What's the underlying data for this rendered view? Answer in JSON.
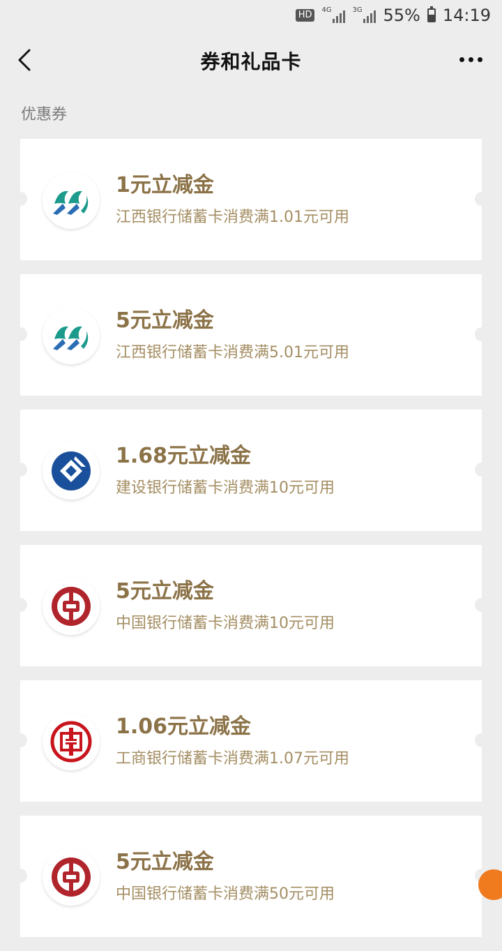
{
  "status_bar": {
    "hd": "HD",
    "network_1": "4G",
    "network_2": "3G",
    "battery_pct": "55%",
    "battery_level": 0.55,
    "time": "14:19"
  },
  "header": {
    "title": "券和礼品卡",
    "back_icon": "chevron-left-icon",
    "more_icon": "more-dots-icon"
  },
  "section": {
    "title": "优惠券"
  },
  "coupons": [
    {
      "amount": "1元立减金",
      "condition": "江西银行储蓄卡消费满1.01元可用",
      "logo": "jiangxi-bank-logo"
    },
    {
      "amount": "5元立减金",
      "condition": "江西银行储蓄卡消费满5.01元可用",
      "logo": "jiangxi-bank-logo"
    },
    {
      "amount": "1.68元立减金",
      "condition": "建设银行储蓄卡消费满10元可用",
      "logo": "ccb-logo"
    },
    {
      "amount": "5元立减金",
      "condition": "中国银行储蓄卡消费满10元可用",
      "logo": "boc-logo"
    },
    {
      "amount": "1.06元立减金",
      "condition": "工商银行储蓄卡消费满1.07元可用",
      "logo": "icbc-logo"
    },
    {
      "amount": "5元立减金",
      "condition": "中国银行储蓄卡消费满50元可用",
      "logo": "boc-logo"
    }
  ],
  "colors": {
    "background": "#ededed",
    "card": "#ffffff",
    "amount_text": "#8b7247",
    "condition_text": "#a48e63",
    "jiangxi_blue": "#2a6db5",
    "jiangxi_teal": "#1c9a8c",
    "ccb_blue": "#1a4f9c",
    "boc_red": "#b0242b",
    "icbc_red": "#c8151d",
    "float_badge": "#f07a1e"
  }
}
